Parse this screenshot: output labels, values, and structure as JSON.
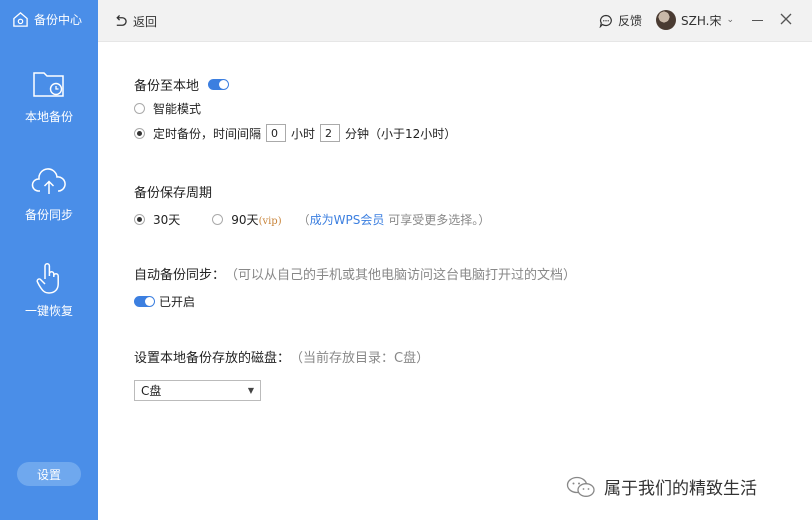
{
  "sidebar": {
    "brand": "备份中心",
    "items": [
      {
        "label": "本地备份",
        "icon": "folder-clock-icon"
      },
      {
        "label": "备份同步",
        "icon": "cloud-upload-icon"
      },
      {
        "label": "一键恢复",
        "icon": "hand-pointer-icon"
      }
    ],
    "settings_label": "设置"
  },
  "topbar": {
    "back_label": "返回",
    "feedback_label": "反馈",
    "username": "SZH.宋"
  },
  "main": {
    "local_backup_title": "备份至本地",
    "local_backup_enabled": true,
    "smart_mode_label": "智能模式",
    "timed_backup_label": "定时备份，时间间隔",
    "interval_hours": "0",
    "hours_unit": "小时",
    "interval_minutes": "2",
    "minutes_unit": "分钟（小于12小时）",
    "retention_title": "备份保存周期",
    "option_30": "30天",
    "option_90": "90天",
    "vip_tag": "(vip)",
    "member_prefix": "（",
    "member_link": "成为WPS会员",
    "member_suffix": "可享受更多选择。）",
    "auto_sync_title": "自动备份同步：",
    "auto_sync_desc": "（可以从自己的手机或其他电脑访问这台电脑打开过的文档）",
    "auto_sync_status": "已开启",
    "disk_title": "设置本地备份存放的磁盘：",
    "disk_current": "（当前存放目录：C盘）",
    "disk_selected": "C盘"
  },
  "watermark": "属于我们的精致生活",
  "colors": {
    "sidebar": "#4a8ee8",
    "accent": "#3c7fe0",
    "vip": "#c8843a"
  }
}
